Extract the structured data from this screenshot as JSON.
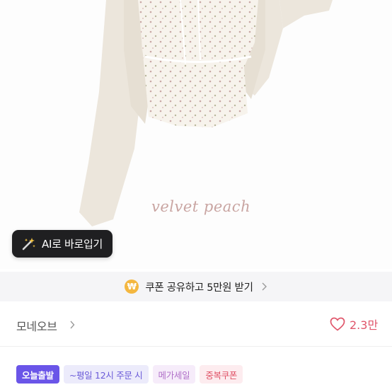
{
  "product_image": {
    "watermark_text": "velvet peach"
  },
  "ai_button": {
    "icon": "magic-wand-icon",
    "label": "AI로 바로입기"
  },
  "coupon_banner": {
    "icon": "won-coin-icon",
    "coin_symbol": "₩",
    "text": "쿠폰 공유하고 5만원 받기"
  },
  "shop": {
    "name": "모네오브",
    "like_count": "2.3만"
  },
  "badges": [
    {
      "label": "오늘출발"
    },
    {
      "label": "~평일 12시 주문 시"
    },
    {
      "label": "메가세일"
    },
    {
      "label": "중복쿠폰"
    }
  ],
  "colors": {
    "accent_purple": "#6a55e8",
    "heart_pink": "#e0566b",
    "coin_yellow": "#f4b740"
  }
}
